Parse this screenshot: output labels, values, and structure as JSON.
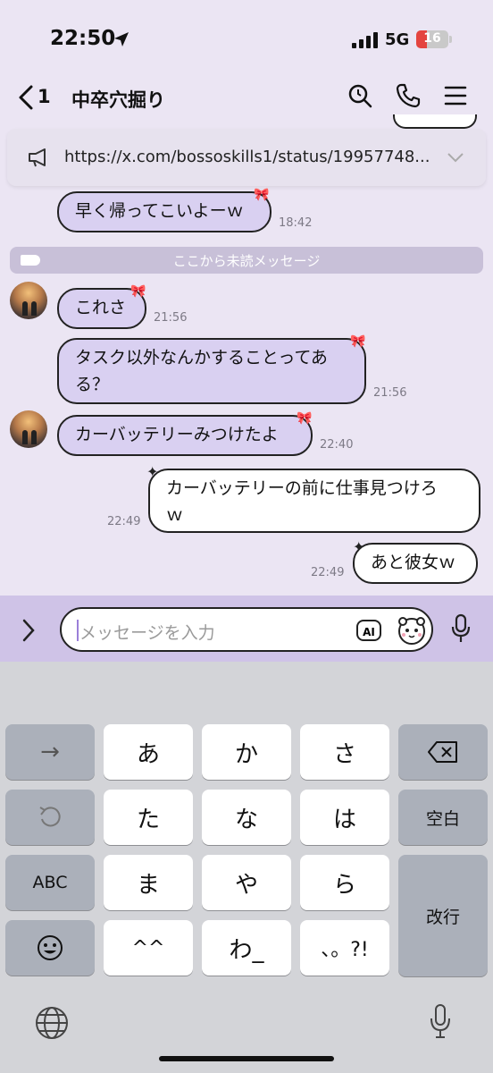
{
  "status_bar": {
    "time": "22:50",
    "network": "5G",
    "battery": "16"
  },
  "header": {
    "back_count": "1",
    "title": "中卒穴掘り"
  },
  "announcement": {
    "text": "https://x.com/bossoskills1/status/19957748..."
  },
  "messages": [
    {
      "text": "早く帰ってこいよーｗ",
      "time": "18:42"
    },
    {
      "text": "これさ",
      "time": "21:56"
    },
    {
      "text_line1": "タスク以外なんかすることってあ",
      "text_line2": "る？",
      "time": "21:56"
    },
    {
      "text": "カーバッテリーみつけたよ",
      "time": "22:40"
    },
    {
      "text_line1": "カーバッテリーの前に仕事見つけろ",
      "text_line2": "ｗ",
      "time": "22:49"
    },
    {
      "text": "あと彼女ｗ",
      "time": "22:49"
    }
  ],
  "unread_divider": "ここから未読メッセージ",
  "input": {
    "placeholder": "メッセージを入力",
    "ai_label": "AI"
  },
  "keyboard": {
    "row1": [
      "→",
      "あ",
      "か",
      "さ"
    ],
    "row2": [
      "た",
      "な",
      "は",
      "空白"
    ],
    "row3": [
      "ABC",
      "ま",
      "や",
      "ら",
      "改行"
    ],
    "row4": [
      "^^",
      "わ_",
      "、。?!"
    ]
  }
}
